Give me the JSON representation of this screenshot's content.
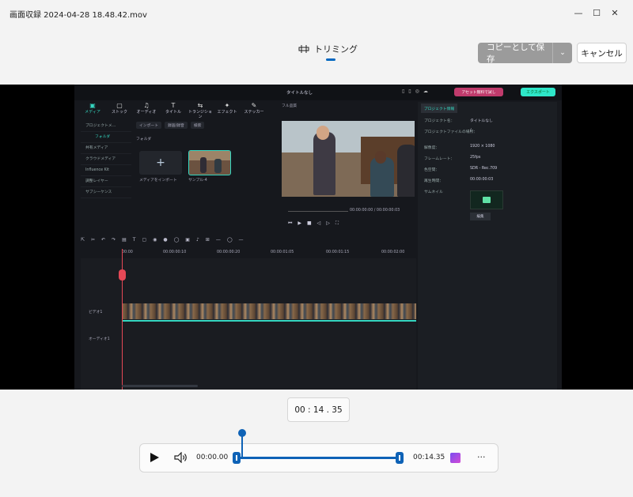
{
  "window": {
    "title": "画面収録 2024-04-28 18.48.42.mov",
    "minimize": "—",
    "maximize": "☐",
    "close": "✕"
  },
  "toolbar": {
    "trim_label": "トリミング",
    "save_label": "コピーとして保存",
    "save_chevron": "⌄",
    "cancel_label": "キャンセル"
  },
  "editor": {
    "title": "タイトルなし",
    "promo": "アセット無料で試し",
    "export": "エクスポート",
    "tabs": [
      "メディア",
      "ストック",
      "オーディオ",
      "タイトル",
      "トランジション",
      "エフェクト",
      "ステッカー"
    ],
    "side_items": [
      "プロジェクトメ…",
      "フォルダ",
      "共有メディア",
      "クラウドメディア",
      "Influence Kit",
      "調整レイヤー",
      "サブシーケンス"
    ],
    "media_bar": [
      "インポート",
      "録画/録音",
      "検索"
    ],
    "folder": "フォルダ",
    "import_label": "メディアをインポート",
    "clip_label": "サンプル-4",
    "preview_head": "フル品質",
    "preview_time": "00:00:00:00 / 00:00:00:03",
    "props_tab": "プロジェクト情報",
    "props": [
      {
        "k": "プロジェクト名：",
        "v": "タイトルなし"
      },
      {
        "k": "プロジェクトファイルの場所：",
        "v": "/"
      },
      {
        "k": "解像度：",
        "v": "1920 × 1080"
      },
      {
        "k": "フレームレート：",
        "v": "25fps"
      },
      {
        "k": "色空間：",
        "v": "SDR - Rec.709"
      },
      {
        "k": "再生時間：",
        "v": "00:00:00:03"
      },
      {
        "k": "サムネイル",
        "v": ""
      }
    ],
    "thumb_btn": "編集",
    "ruler": [
      "00:00",
      "00:00:00:10",
      "00:00:00:20",
      "00:00:01:05",
      "00:00:01:15",
      "00:00:02:00"
    ],
    "video_track": "ビデオ1",
    "audio_track": "オーディオ1"
  },
  "player": {
    "timecode": "00 : 14 . 35",
    "start": "00:00.00",
    "end": "00:14.35",
    "more": "···",
    "position_fraction": 0.05
  },
  "colors": {
    "accent": "#0e62b6",
    "teal": "#35d6c0",
    "playhead": "#e54856"
  }
}
